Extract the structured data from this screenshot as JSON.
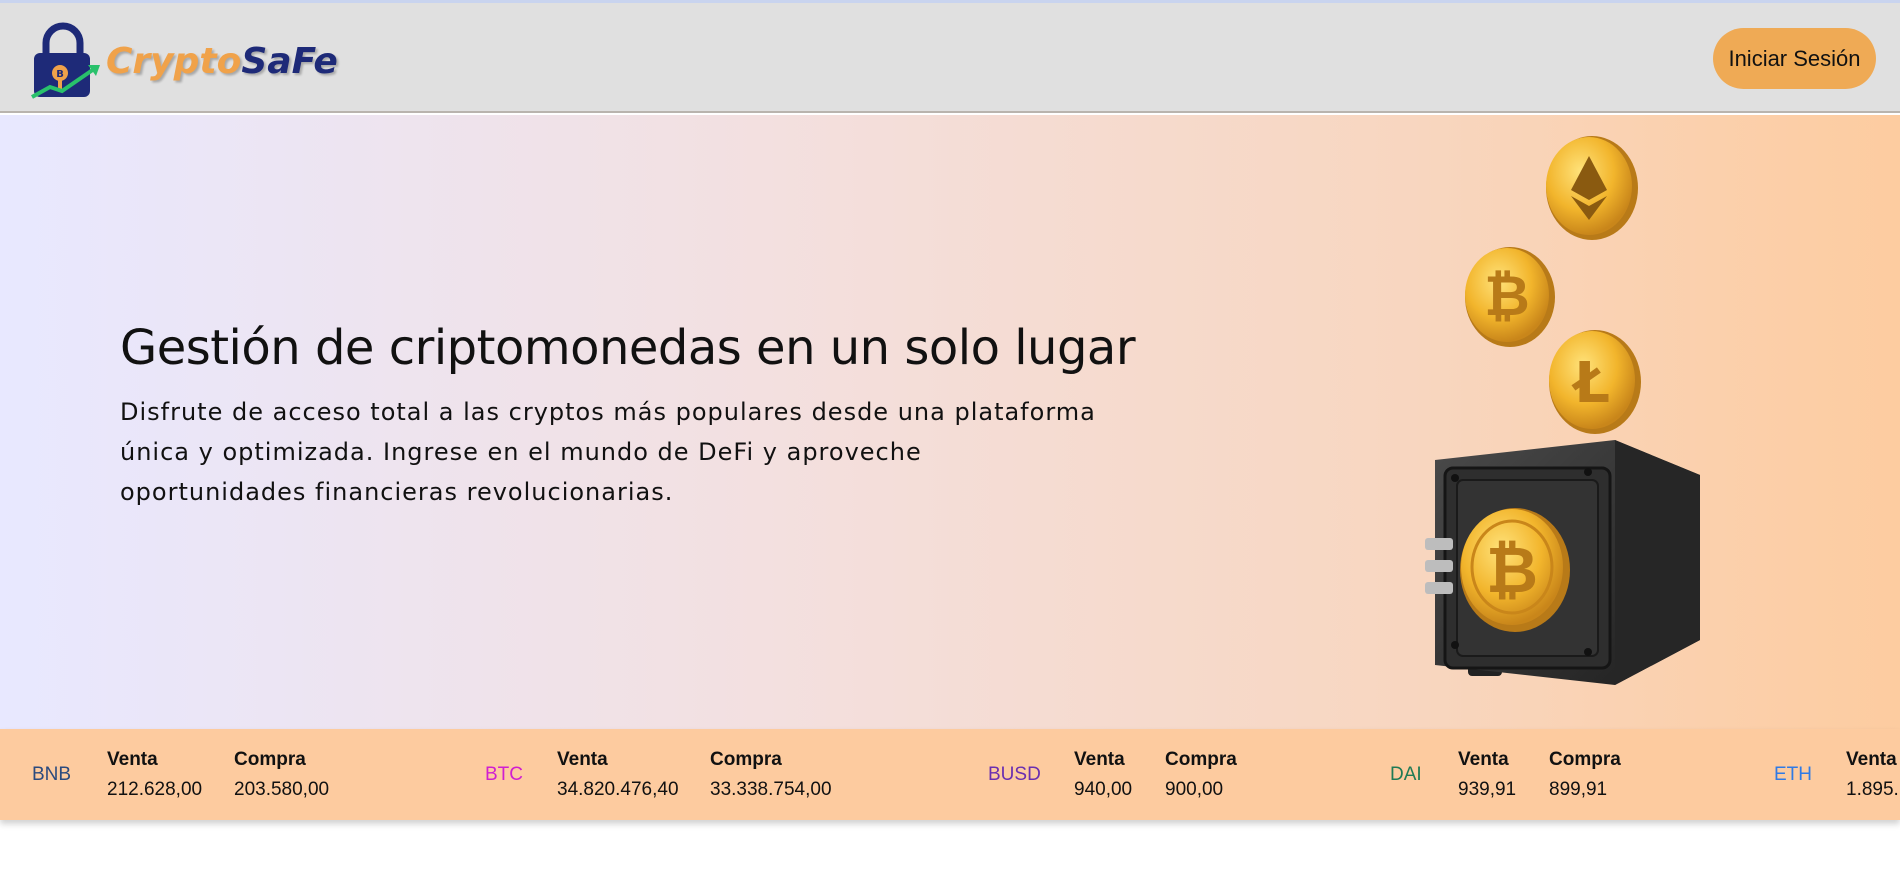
{
  "brand": {
    "part1": "Crypto",
    "part2": "SaFe"
  },
  "header": {
    "login_label": "Iniciar Sesión"
  },
  "hero": {
    "title": "Gestión de criptomonedas en un solo lugar",
    "description": "Disfrute de acceso total a las cryptos más populares desde una plataforma única y optimizada. Ingrese en el mundo de DeFi y aproveche oportunidades financieras revolucionarias."
  },
  "ticker": {
    "sell_label": "Venta",
    "buy_label": "Compra",
    "items": [
      {
        "symbol": "BNB",
        "color": "#2b4a7e",
        "sell": "212.628,00",
        "buy": "203.580,00"
      },
      {
        "symbol": "BTC",
        "color": "#d01fd0",
        "sell": "34.820.476,40",
        "buy": "33.338.754,00"
      },
      {
        "symbol": "BUSD",
        "color": "#6a2fb0",
        "sell": "940,00",
        "buy": "900,00"
      },
      {
        "symbol": "DAI",
        "color": "#1f7a55",
        "sell": "939,91",
        "buy": "899,91"
      },
      {
        "symbol": "ETH",
        "color": "#2f7ae5",
        "sell": "1.895.",
        "buy": ""
      }
    ]
  }
}
